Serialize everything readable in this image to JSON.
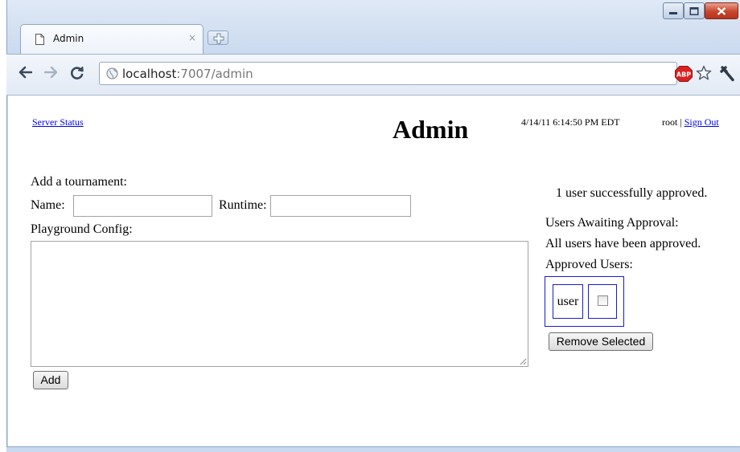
{
  "browser": {
    "tab": {
      "title": "Admin",
      "close_glyph": "×"
    },
    "url": {
      "host": "localhost",
      "path": ":7007/admin"
    },
    "abp_label": "ABP"
  },
  "header": {
    "status_link": "Server Status",
    "title": "Admin",
    "timestamp": "4/14/11 6:14:50 PM EDT",
    "username": "root",
    "separator": "|",
    "sign_out": "Sign Out"
  },
  "tournament_form": {
    "heading": "Add a tournament:",
    "name_label": "Name:",
    "name_value": "",
    "runtime_label": "Runtime:",
    "runtime_value": "",
    "config_label": "Playground Config:",
    "config_value": "",
    "add_button": "Add"
  },
  "approval_panel": {
    "notice": "1 user successfully approved.",
    "awaiting_heading": "Users Awaiting Approval:",
    "awaiting_message": "All users have been approved.",
    "approved_heading": "Approved Users:",
    "approved_users": [
      {
        "name": "user",
        "selected": false
      }
    ],
    "remove_button": "Remove Selected"
  },
  "colors": {
    "link": "#0000ee",
    "table_border": "#1a1ad0",
    "window_close": "#c9452c",
    "chrome_frame": "#c9d9ee"
  }
}
